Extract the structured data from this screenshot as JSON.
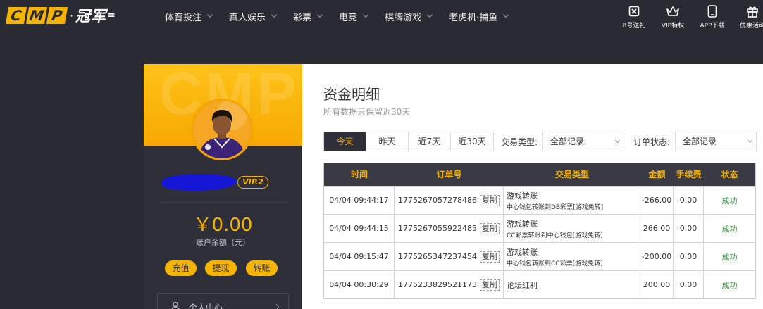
{
  "logo": {
    "letters": [
      "C",
      "M",
      "P"
    ],
    "cn": "冠军"
  },
  "nav": [
    "体育投注",
    "真人娱乐",
    "彩票",
    "电竞",
    "棋牌游戏",
    "老虎机·捕鱼"
  ],
  "quick_links": [
    {
      "label": "8号送礼",
      "icon": "gift-card-icon"
    },
    {
      "label": "VIP特权",
      "icon": "crown-icon"
    },
    {
      "label": "APP下载",
      "icon": "phone-icon"
    },
    {
      "label": "优惠活动",
      "icon": "gift-icon"
    }
  ],
  "sidebar": {
    "watermark": "CMP",
    "vip_level": "VIP.2",
    "balance": "￥0.00",
    "balance_label": "账户余额（元）",
    "buttons": [
      "充值",
      "提现",
      "转账"
    ],
    "menu_item": "个人中心"
  },
  "main": {
    "title": "资金明细",
    "subtitle": "所有数据只保留近30天",
    "date_tabs": [
      "今天",
      "昨天",
      "近7天",
      "近30天"
    ],
    "active_tab": "今天",
    "filters": {
      "type_label": "交易类型:",
      "type_value": "全部记录",
      "status_label": "订单状态:",
      "status_value": "全部记录"
    },
    "table": {
      "headers": [
        "时间",
        "订单号",
        "交易类型",
        "金额",
        "手续费",
        "状态"
      ],
      "copy_label": "复制",
      "rows": [
        {
          "time": "04/04 09:44:17",
          "order": "1775267057278486",
          "type": "游戏转账",
          "type_detail": "中心钱包转账到DB彩票[游戏免转]",
          "amount": "-266.00",
          "fee": "0.00",
          "status": "成功"
        },
        {
          "time": "04/04 09:44:15",
          "order": "1775267055922485",
          "type": "游戏转账",
          "type_detail": "CC彩票转账到中心钱包[游戏免转]",
          "amount": "266.00",
          "fee": "0.00",
          "status": "成功"
        },
        {
          "time": "04/04 09:15:47",
          "order": "1775265347237454",
          "type": "游戏转账",
          "type_detail": "中心钱包转账到CC彩票[游戏免转]",
          "amount": "-200.00",
          "fee": "0.00",
          "status": "成功"
        },
        {
          "time": "04/04 00:30:29",
          "order": "1775233829521173",
          "type": "论坛红利",
          "type_detail": "",
          "amount": "200.00",
          "fee": "0.00",
          "status": "成功"
        }
      ]
    }
  },
  "colors": {
    "accent": "#f5b400",
    "dark": "#2a2a33",
    "success": "#3c9a3c",
    "redaction": "#1616d6"
  }
}
